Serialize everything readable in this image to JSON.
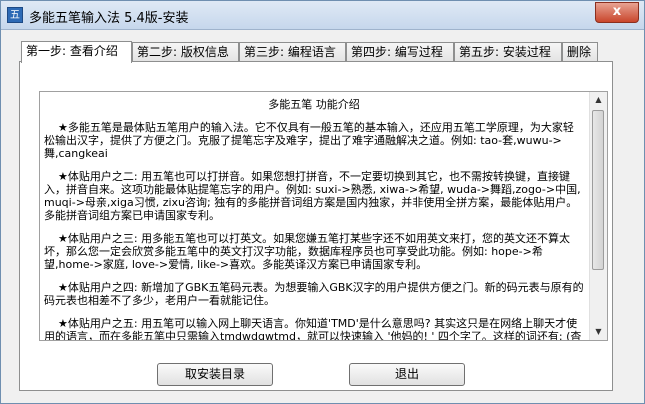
{
  "window": {
    "title": "多能五笔输入法 5.4版-安装",
    "close_glyph": "x"
  },
  "tabs": [
    {
      "label": "第一步: 查看介绍"
    },
    {
      "label": "第二步: 版权信息"
    },
    {
      "label": "第三步: 编程语言"
    },
    {
      "label": "第四步: 编写过程"
    },
    {
      "label": "第五步: 安装过程"
    },
    {
      "label": "删除"
    }
  ],
  "content": {
    "heading": "多能五笔 功能介绍",
    "paragraphs": [
      "    ★多能五笔是最体贴五笔用户的输入法。它不仅具有一般五笔的基本输入，还应用五笔工学原理，为大家轻松输出汉字，提供了方便之门。克服了提笔忘字及难字，提出了难字通融解决之道。例如: tao-套,wuwu->舞,cangkeai",
      "    ★体贴用户之二: 用五笔也可以打拼音。如果您想打拼音，不一定要切换到其它，也不需按转换键，直接键入，拼音自来。这项功能最体贴提笔忘字的用户。例如: suxi->熟悉, xiwa->希望, wuda->舞蹈,zogo->中国, muqi->母亲,xiga习惯, zixu咨询; 独有的多能拼音词组方案是国内独家，并非使用全拼方案，最能体贴用户。多能拼音词组方案已申请国家专利。",
      "    ★体贴用户之三: 用多能五笔也可以打英文。如果您嫌五笔打某些字还不如用英文来打，您的英文还不算太坏，那么您一定会欣赏多能五笔中的英文打汉字功能，数据库程序员也可享受此功能。例如: hope->希望,home->家庭, love->爱情, like->喜欢。多能英译汉方案已申请国家专利。",
      "    ★体贴用户之四: 新增加了GBK五笔码元表。为想要输入GBK汉字的用户提供方便之门。新的码元表与原有的码元表也相差不了多少，老用户一看就能记住。",
      "    ★体贴用户之五: 用五笔可以输入网上聊天语言。你知道'TMD'是什么意思吗? 其实这只是在网络上聊天才使用的语言，而在多能五笔中只需输入tmdwdgwtmd，就可以快速输入 '他妈的! ' 四个字了。这样的词还有: (杳蕉损脑、酷毙、呆菜、呆瓜了，上网，网易，肉麻，搜狐，新浪，网页，下载，美眉)"
    ]
  },
  "buttons": {
    "cancel_install": "取安装目录",
    "exit": "退出"
  }
}
